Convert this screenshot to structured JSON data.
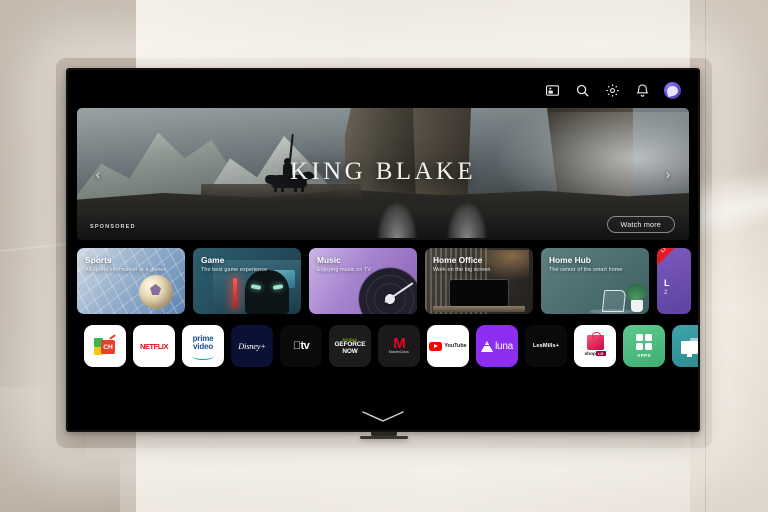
{
  "scene": {
    "description": "LG webOS smart TV home screen mounted on a living room wall"
  },
  "topbar": {
    "icons": [
      {
        "name": "multiview-icon",
        "label": "Multi View"
      },
      {
        "name": "search-icon",
        "label": "Search"
      },
      {
        "name": "settings-gear-icon",
        "label": "Settings"
      },
      {
        "name": "notification-bell-icon",
        "label": "Notifications"
      }
    ],
    "avatar_label": "Profile"
  },
  "hero": {
    "title": "KING BLAKE",
    "sponsored_label": "SPONSORED",
    "watch_more_label": "Watch more",
    "prev_arrow": "‹",
    "next_arrow": "›"
  },
  "cards": [
    {
      "title": "Sports",
      "subtitle": "All sports information at a glance",
      "accent": "#7f9ec2"
    },
    {
      "title": "Game",
      "subtitle": "The best game experience",
      "accent": "#26505f"
    },
    {
      "title": "Music",
      "subtitle": "Enjoying music on TV",
      "accent": "#a683cf"
    },
    {
      "title": "Home Office",
      "subtitle": "Work on the big screen",
      "accent": "#35312c"
    },
    {
      "title": "Home Hub",
      "subtitle": "The center of the smart home",
      "accent": "#4e7173"
    }
  ],
  "live_card": {
    "ribbon": "LIVE",
    "title": "L",
    "subtitle": "2",
    "accent": "#e01b24"
  },
  "apps": [
    {
      "name": "lg-channels",
      "label": "CH"
    },
    {
      "name": "netflix",
      "label": "NETFLIX"
    },
    {
      "name": "prime-video",
      "label": "prime",
      "label2": "video"
    },
    {
      "name": "disney-plus",
      "label": "Disney+"
    },
    {
      "name": "apple-tv",
      "label": "tv"
    },
    {
      "name": "geforce-now",
      "label": "NVIDIA",
      "label2": "GEFORCE",
      "label3": "NOW"
    },
    {
      "name": "masterclass",
      "label": "M",
      "label2": "MasterClass"
    },
    {
      "name": "youtube",
      "label": "YouTube"
    },
    {
      "name": "amazon-luna",
      "label": "luna"
    },
    {
      "name": "lesmills",
      "label": "LesMills+"
    },
    {
      "name": "shop-lg",
      "label": "shop",
      "label2": "LG"
    },
    {
      "name": "apps",
      "label": "APPS"
    },
    {
      "name": "screen-share",
      "label": "Screen Share"
    }
  ],
  "bottom": {
    "chevron_label": "Show more"
  },
  "colors": {
    "screen_bg": "#000000",
    "netflix_red": "#e50914",
    "youtube_red": "#ff0000",
    "luna_purple": "#8c2df0",
    "apps_green": "#3fae72",
    "share_teal": "#2d888f",
    "live_red": "#e01b24"
  }
}
